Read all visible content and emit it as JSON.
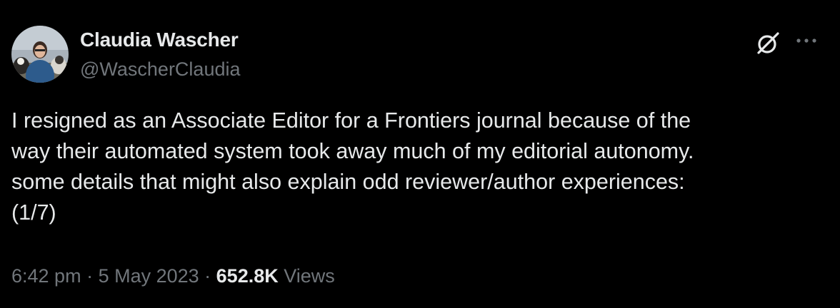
{
  "author": {
    "name": "Claudia Wascher",
    "handle": "@WascherClaudia"
  },
  "tweet": {
    "text": "I resigned as an Associate Editor for a Frontiers journal because of the\nway their automated system took away much of my editorial autonomy.\nsome details that might also explain odd reviewer/author experiences:\n(1/7)",
    "time": "6:42 pm",
    "separator": " · ",
    "date": "5 May 2023",
    "views_count": "652.8K",
    "views_label": " Views"
  },
  "icons": {
    "grok": "grok-icon",
    "more": "more-icon"
  },
  "colors": {
    "background": "#000000",
    "primary_text": "#e7e9ea",
    "secondary_text": "#71767b"
  }
}
